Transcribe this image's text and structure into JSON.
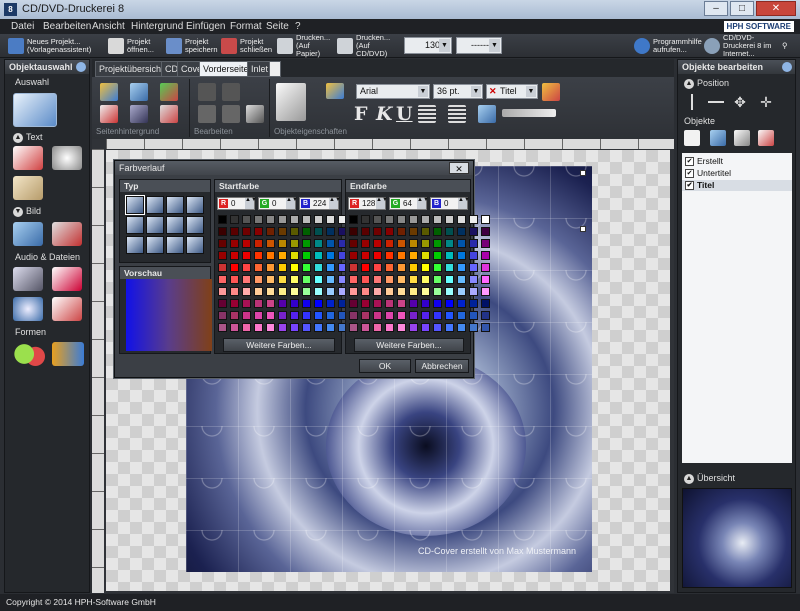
{
  "window": {
    "title": "CD/DVD-Druckerei 8",
    "app_icon": "8"
  },
  "menu": [
    "Datei",
    "Bearbeiten",
    "Ansicht",
    "Hintergrund",
    "Einfügen",
    "Format",
    "Seite",
    "?"
  ],
  "brand": "HPH SOFTWARE",
  "toolbar": {
    "new_project": "Neues Projekt... (Vorlagenassistent)",
    "open_project": "Projekt öffnen...",
    "save_project": "Projekt speichern",
    "close_project": "Projekt schließen",
    "print_paper": "Drucken... (Auf Papier)",
    "print_cd": "Drucken... (Auf CD/DVD)",
    "zoom": "130%",
    "page_select": "------",
    "help": "Programmhilfe aufrufen...",
    "internet": "CD/DVD-Druckerei 8 im Internet..."
  },
  "left_panel": {
    "title": "Objektauswahl",
    "sections": {
      "auswahl": "Auswahl",
      "text": "Text",
      "bild": "Bild",
      "audio": "Audio & Dateien",
      "formen": "Formen"
    }
  },
  "tabs": [
    "Projektübersicht",
    "CD",
    "Cover",
    "Vorderseite",
    "Inlet"
  ],
  "ribbon": {
    "group_background": "Seitenhintergrund",
    "group_edit": "Bearbeiten",
    "group_props": "Objekteigenschaften",
    "font": "Arial",
    "font_size": "36 pt.",
    "style": "Titel"
  },
  "canvas": {
    "caption": "CD-Cover erstellt von Max Mustermann"
  },
  "dialog": {
    "title": "Farbverlauf",
    "typ": "Typ",
    "vorschau": "Vorschau",
    "startfarbe": "Startfarbe",
    "endfarbe": "Endfarbe",
    "start_rgb": {
      "r": "0",
      "g": "0",
      "b": "224"
    },
    "end_rgb": {
      "r": "128",
      "g": "64",
      "b": "0"
    },
    "more_colors": "Weitere Farben...",
    "ok": "OK",
    "cancel": "Abbrechen"
  },
  "right_panel": {
    "title": "Objekte bearbeiten",
    "position": "Position",
    "objekte": "Objekte",
    "items": [
      "Erstellt",
      "Untertitel",
      "Titel"
    ],
    "overview": "Übersicht"
  },
  "status": "Copyright © 2014 HPH-Software GmbH",
  "palette": [
    [
      "#000000",
      "#333333",
      "#555555",
      "#777777",
      "#888888",
      "#999999",
      "#aaaaaa",
      "#bbbbbb",
      "#cccccc",
      "#dddddd",
      "#eeeeee",
      "#ffffff"
    ],
    [
      "#3a0000",
      "#5a0000",
      "#700000",
      "#880000",
      "#702000",
      "#6a3a00",
      "#5a5a00",
      "#006000",
      "#005050",
      "#003060",
      "#1a1060",
      "#400040"
    ],
    [
      "#660000",
      "#990000",
      "#bb0000",
      "#cc2200",
      "#cc5500",
      "#bb8800",
      "#999900",
      "#009900",
      "#008888",
      "#0055aa",
      "#2a2aaa",
      "#770077"
    ],
    [
      "#990000",
      "#cc0000",
      "#ee0000",
      "#ff3300",
      "#ff7700",
      "#ffaa00",
      "#dddd00",
      "#00cc00",
      "#00bbbb",
      "#0077dd",
      "#4444dd",
      "#aa00aa"
    ],
    [
      "#cc3333",
      "#ff0000",
      "#ff4444",
      "#ff6633",
      "#ff9933",
      "#ffcc00",
      "#ffff00",
      "#33ff33",
      "#33dddd",
      "#3399ff",
      "#6666ff",
      "#dd33dd"
    ],
    [
      "#ff6666",
      "#ff5555",
      "#ff7777",
      "#ff9966",
      "#ffbb66",
      "#ffdd44",
      "#ffff66",
      "#66ff66",
      "#66ffff",
      "#66bbff",
      "#8888ff",
      "#ff66ff"
    ],
    [
      "#ff9999",
      "#ff8888",
      "#ffaaaa",
      "#ffcc99",
      "#ffdd99",
      "#ffee88",
      "#ffff99",
      "#99ff99",
      "#99ffff",
      "#99ccff",
      "#aaaaff",
      "#ff99ff"
    ],
    [
      "#660033",
      "#990033",
      "#aa1155",
      "#bb3377",
      "#cc4488",
      "#5500aa",
      "#3300cc",
      "#1100ee",
      "#0000ff",
      "#0022cc",
      "#002299",
      "#001166"
    ],
    [
      "#883366",
      "#aa3366",
      "#cc3388",
      "#dd44aa",
      "#ee55bb",
      "#7722cc",
      "#5522ee",
      "#3333ff",
      "#2255ff",
      "#2266dd",
      "#2255bb",
      "#223388"
    ],
    [
      "#aa5588",
      "#cc5599",
      "#ee66aa",
      "#ff77cc",
      "#ff88dd",
      "#9944ee",
      "#7744ff",
      "#5555ff",
      "#4477ff",
      "#4488ee",
      "#4477cc",
      "#3355aa"
    ]
  ]
}
